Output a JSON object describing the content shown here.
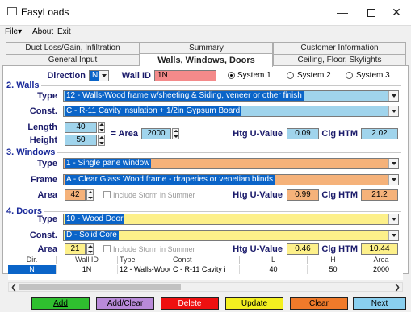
{
  "window": {
    "title": "EasyLoads"
  },
  "menu": [
    "File",
    "About",
    "Exit"
  ],
  "tabs": {
    "row1": [
      "Duct Loss/Gain, Infiltration",
      "Summary",
      "Customer Information"
    ],
    "row2": [
      "General Input",
      "Walls, Windows, Doors",
      "Ceiling, Floor, Skylights"
    ],
    "active": "Walls, Windows, Doors"
  },
  "top": {
    "direction_label": "Direction",
    "direction_value": "N",
    "wallid_label": "Wall ID",
    "wallid_value": "1N",
    "systems": [
      "System 1",
      "System 2",
      "System 3"
    ],
    "selected_system": "System 1"
  },
  "walls": {
    "heading": "2. Walls",
    "type_label": "Type",
    "type_value": "12 - Walls-Wood frame w/sheeting & Siding, veneer or other finish",
    "const_label": "Const.",
    "const_value": "C - R-11 Cavity insulation + 1/2in Gypsum Board",
    "length_label": "Length",
    "length_value": "40",
    "height_label": "Height",
    "height_value": "50",
    "area_label": "= Area",
    "area_value": "2000",
    "uvalue_label": "Htg U-Value",
    "uvalue": "0.09",
    "clghtm_label": "Clg HTM",
    "clghtm": "2.02"
  },
  "windows": {
    "heading": "3. Windows",
    "type_label": "Type",
    "type_value": "1 - Single pane window",
    "frame_label": "Frame",
    "frame_value": "A - Clear Glass Wood frame - draperies or venetian blinds",
    "area_label": "Area",
    "area_value": "42",
    "storm_label": "Include Storm in Summer",
    "uvalue_label": "Htg U-Value",
    "uvalue": "0.99",
    "clghtm_label": "Clg HTM",
    "clghtm": "21.2"
  },
  "doors": {
    "heading": "4. Doors",
    "type_label": "Type",
    "type_value": "10 - Wood Door",
    "const_label": "Const.",
    "const_value": "D - Solid Core",
    "area_label": "Area",
    "area_value": "21",
    "storm_label": "Include Storm in Summer",
    "uvalue_label": "Htg U-Value",
    "uvalue": "0.46",
    "clghtm_label": "Clg HTM",
    "clghtm": "10.44"
  },
  "table": {
    "columns": [
      "Dir.",
      "Wall ID",
      "Type",
      "Const",
      "L",
      "H",
      "Area"
    ],
    "rows": [
      [
        "N",
        "1N",
        "12 - Walls-Wooc",
        "C - R-11 Cavity i",
        "40",
        "50",
        "2000"
      ]
    ]
  },
  "buttons": [
    "Add",
    "Add/Clear",
    "Delete",
    "Update",
    "Clear",
    "Next"
  ],
  "colors": {
    "walls_field": "#a0d4ec",
    "windows_field": "#f5b27a",
    "doors_field": "#fdf08a",
    "red_field": "#f48a8a",
    "btn_add": "#2fbf2f",
    "btn_addclear": "#b98ad9",
    "btn_delete": "#ee1010",
    "btn_update": "#f4f020",
    "btn_clear": "#f07a2a",
    "btn_next": "#8ad0f0"
  }
}
